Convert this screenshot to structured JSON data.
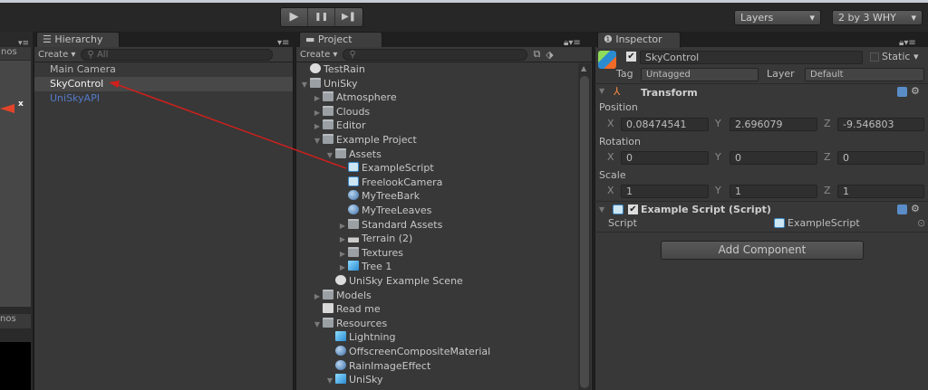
{
  "toolbar": {
    "play": "▶",
    "pause": "❚❚",
    "step": "▶❚",
    "layers": "Layers",
    "layout": "2 by 3 WHY",
    "dropdown_arrow": "▾"
  },
  "scene_panel": {
    "gizmos_top": "nos",
    "gizmos_bottom": "nos",
    "axis_x": "x"
  },
  "hierarchy": {
    "tab": "Hierarchy",
    "create": "Create ▾",
    "search_placeholder": "All",
    "items": [
      {
        "label": "Main Camera",
        "state": "normal"
      },
      {
        "label": "SkyControl",
        "state": "selected"
      },
      {
        "label": "UniSkyAPI",
        "state": "prefab"
      }
    ]
  },
  "project": {
    "tab": "Project",
    "create": "Create ▾",
    "items": [
      {
        "label": "TestRain",
        "level": 0,
        "icon": "scene",
        "arrow": ""
      },
      {
        "label": "UniSky",
        "level": 0,
        "icon": "folder",
        "arrow": "▼"
      },
      {
        "label": "Atmosphere",
        "level": 1,
        "icon": "folder",
        "arrow": "▶"
      },
      {
        "label": "Clouds",
        "level": 1,
        "icon": "folder",
        "arrow": "▶"
      },
      {
        "label": "Editor",
        "level": 1,
        "icon": "folder",
        "arrow": "▶"
      },
      {
        "label": "Example Project",
        "level": 1,
        "icon": "folder",
        "arrow": "▼"
      },
      {
        "label": "Assets",
        "level": 2,
        "icon": "folder",
        "arrow": "▼"
      },
      {
        "label": "ExampleScript",
        "level": 3,
        "icon": "script",
        "arrow": ""
      },
      {
        "label": "FreelookCamera",
        "level": 3,
        "icon": "script",
        "arrow": ""
      },
      {
        "label": "MyTreeBark",
        "level": 3,
        "icon": "mat",
        "arrow": ""
      },
      {
        "label": "MyTreeLeaves",
        "level": 3,
        "icon": "mat",
        "arrow": ""
      },
      {
        "label": "Standard Assets",
        "level": 3,
        "icon": "folder",
        "arrow": "▶"
      },
      {
        "label": "Terrain (2)",
        "level": 3,
        "icon": "terrain",
        "arrow": "▶"
      },
      {
        "label": "Textures",
        "level": 3,
        "icon": "folder",
        "arrow": "▶"
      },
      {
        "label": "Tree 1",
        "level": 3,
        "icon": "prefab",
        "arrow": "▶"
      },
      {
        "label": "UniSky Example Scene",
        "level": 2,
        "icon": "scene",
        "arrow": ""
      },
      {
        "label": "Models",
        "level": 1,
        "icon": "folder",
        "arrow": "▶"
      },
      {
        "label": "Read me",
        "level": 1,
        "icon": "doc",
        "arrow": ""
      },
      {
        "label": "Resources",
        "level": 1,
        "icon": "folder",
        "arrow": "▼"
      },
      {
        "label": "Lightning",
        "level": 2,
        "icon": "prefab",
        "arrow": ""
      },
      {
        "label": "OffscreenCompositeMaterial",
        "level": 2,
        "icon": "mat",
        "arrow": ""
      },
      {
        "label": "RainImageEffect",
        "level": 2,
        "icon": "mat",
        "arrow": ""
      },
      {
        "label": "UniSky",
        "level": 2,
        "icon": "prefab",
        "arrow": "▼"
      }
    ]
  },
  "inspector": {
    "tab": "Inspector",
    "object_name": "SkyControl",
    "static": "Static ▾",
    "tag_label": "Tag",
    "tag": "Untagged",
    "layer_label": "Layer",
    "layer": "Default",
    "transform": {
      "title": "Transform",
      "position_label": "Position",
      "rotation_label": "Rotation",
      "scale_label": "Scale",
      "position": {
        "x": "0.08474541",
        "y": "2.696079",
        "z": "-9.546803"
      },
      "rotation": {
        "x": "0",
        "y": "0",
        "z": "0"
      },
      "scale": {
        "x": "1",
        "y": "1",
        "z": "1"
      }
    },
    "script_component": {
      "title": "Example Script (Script)",
      "script_label": "Script",
      "script_value": "ExampleScript"
    },
    "add_component": "Add Component"
  },
  "axes": {
    "x": "X",
    "y": "Y",
    "z": "Z"
  },
  "annotation_color": "#d0201c"
}
